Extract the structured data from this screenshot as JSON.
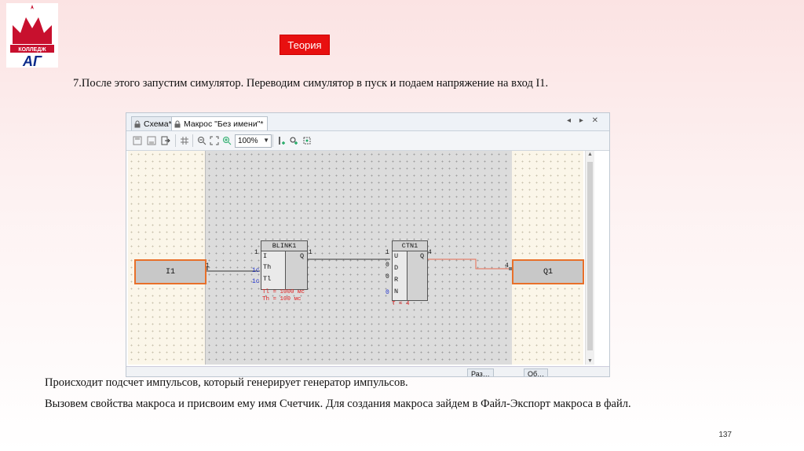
{
  "logo": {
    "text": "КОЛЛЕДЖ",
    "letters": "АГ"
  },
  "theory_button": {
    "label": "Теория"
  },
  "step_text": "7.После этого запустим симулятор. Переводим симулятор в пуск и подаем напряжение на вход I1.",
  "editor": {
    "tabs": [
      {
        "label": "Схема*"
      },
      {
        "label": "Макрос \"Без имени\"*"
      }
    ],
    "tab_controls": "◂ ▸ ✕",
    "zoom_value": "100%",
    "input_block": {
      "label": "I1",
      "pin": "1"
    },
    "output_block": {
      "label": "Q1",
      "pin": "4"
    },
    "blink_block": {
      "title": "BLINK1",
      "pins": [
        "I",
        "Th",
        "Tl"
      ],
      "out": "Q",
      "in_value": "1",
      "th_value": "1c",
      "tl_value": "1c",
      "out_value": "1",
      "param1": "Tl = 1000 мс",
      "param2": "Th = 100 мс"
    },
    "ctn_block": {
      "title": "CTN1",
      "pins": [
        "U",
        "D",
        "R",
        "N"
      ],
      "out": "Q",
      "u_value": "1",
      "d_value": "0",
      "r_value": "0",
      "n_value": "0",
      "out_value": "4",
      "param": "T = 4"
    },
    "bottom_tabs": [
      "Раз…",
      "Об…"
    ]
  },
  "para1": "Происходит подсчет импульсов, который генерирует генератор импульсов.",
  "para2": "Вызовем свойства макроса и присвоим ему имя Счетчик. Для создания макроса зайдем в Файл-Экспорт макроса в файл.",
  "page_number": "137",
  "colors": {
    "accent_red": "#e81010",
    "io_border": "#e8702a",
    "param_red": "#e02020"
  }
}
